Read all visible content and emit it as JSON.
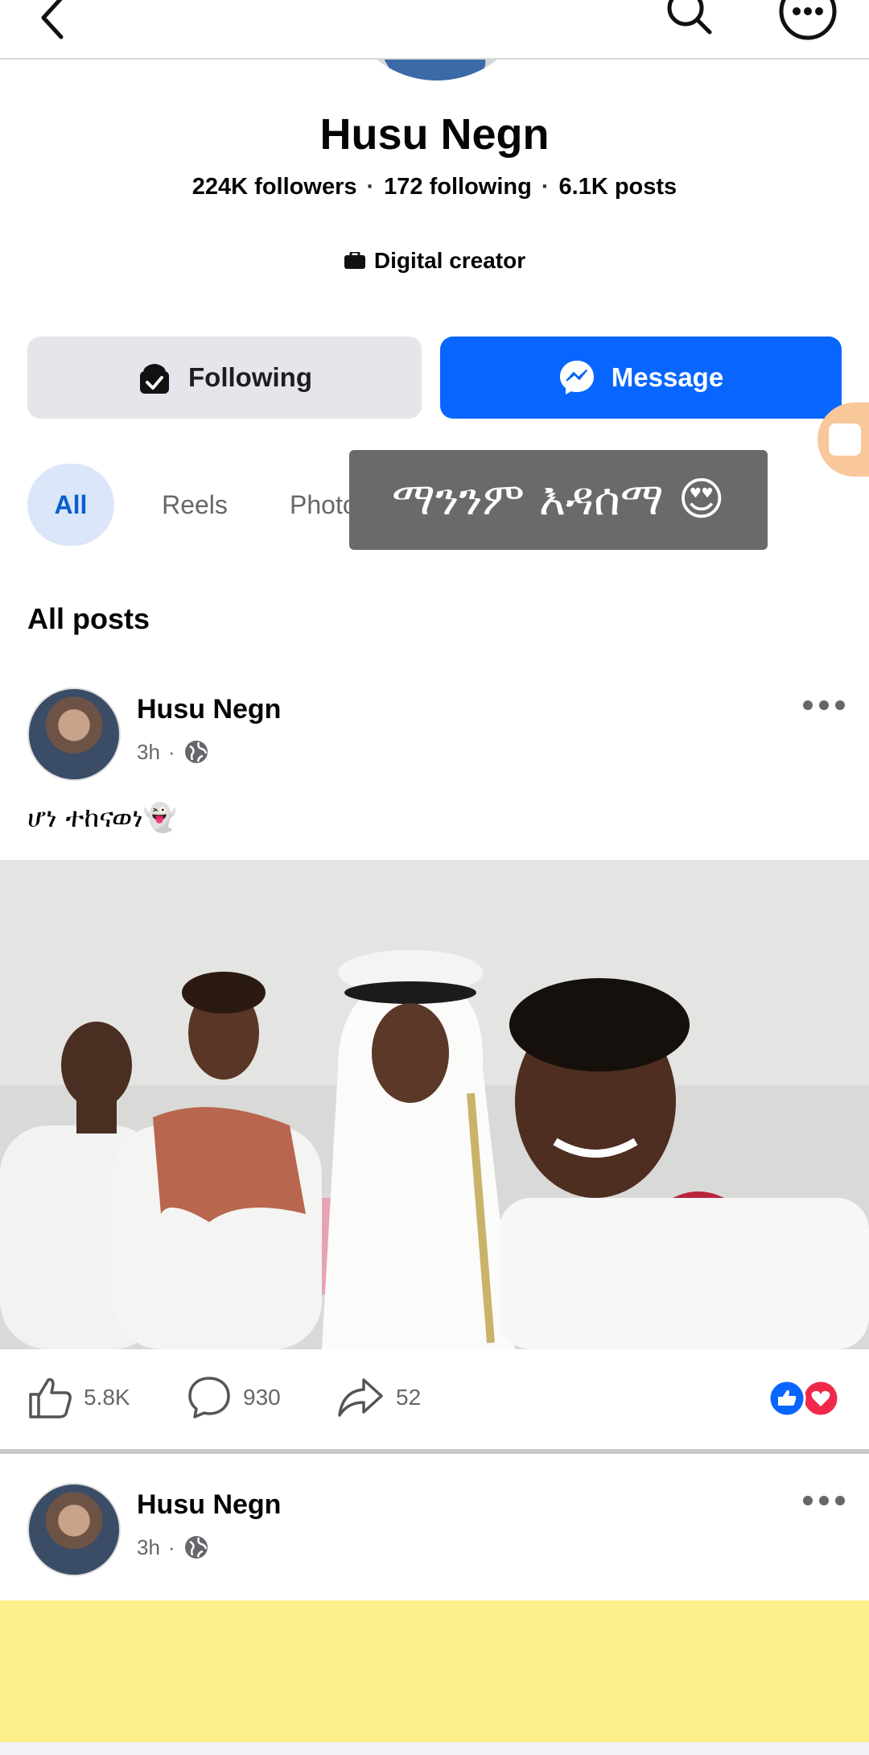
{
  "profile": {
    "name": "Husu Negn",
    "followers": "224K followers",
    "following_count": "172 following",
    "posts": "6.1K posts",
    "separator": "·",
    "category": "Digital creator"
  },
  "buttons": {
    "following": "Following",
    "message": "Message"
  },
  "tabs": [
    "All",
    "Reels",
    "Photos"
  ],
  "overlay_caption": "ማንንም እዳሰማ 😍",
  "section_title": "All posts",
  "posts": [
    {
      "author": "Husu Negn",
      "time": "3h",
      "text": "ሆነ ተከናወነ👻",
      "likes": "5.8K",
      "comments": "930",
      "shares": "52"
    },
    {
      "author": "Husu Negn",
      "time": "3h"
    }
  ],
  "colors": {
    "accent": "#0866ff",
    "tab_active_bg": "#dbe7f9",
    "secondary_button": "#e4e6eb",
    "yellow_post": "#fdf08b"
  },
  "icons": [
    "back-arrow-icon",
    "search-icon",
    "more-options-icon",
    "briefcase-icon",
    "following-check-icon",
    "messenger-icon",
    "globe-icon",
    "like-icon",
    "comment-icon",
    "share-icon",
    "like-reaction-icon",
    "love-reaction-icon"
  ]
}
